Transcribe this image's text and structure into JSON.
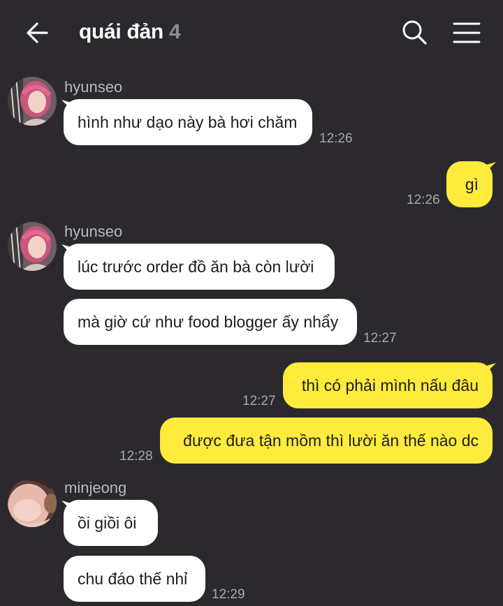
{
  "header": {
    "title": "quái đản",
    "member_count": "4"
  },
  "messages": [
    {
      "sender": "hyunseo",
      "text": "hình như dạo này bà hơi chăm",
      "time": "12:26"
    },
    {
      "text": "gì",
      "time": "12:26"
    },
    {
      "sender": "hyunseo",
      "text": "lúc trước order đồ ăn bà còn lười"
    },
    {
      "text": "mà giờ cứ như food blogger ấy nhẩy",
      "time": "12:27"
    },
    {
      "text": "thì có phải mình nấu đâu",
      "time": "12:27"
    },
    {
      "text": "được đưa tận mồm thì lười ăn thế nào dc",
      "time": "12:28"
    },
    {
      "sender": "minjeong",
      "text": "ồi giồi ôi"
    },
    {
      "text": "chu đáo thế nhỉ",
      "time": "12:29"
    }
  ],
  "colors": {
    "background": "#2b292d",
    "incoming_bubble": "#ffffff",
    "outgoing_bubble": "#ffeb3b",
    "muted_text": "#a9a9ad"
  },
  "icons": {
    "back": "arrow-left-icon",
    "search": "search-icon",
    "menu": "hamburger-menu-icon"
  }
}
